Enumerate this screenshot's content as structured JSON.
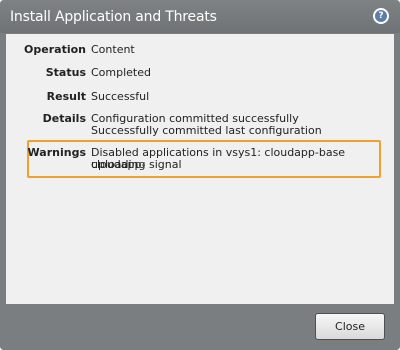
{
  "dialog": {
    "title": "Install Application and Threats",
    "help_icon": "question-mark-icon",
    "close_label": "Close"
  },
  "fields": {
    "operation": {
      "label": "Operation",
      "value": "Content"
    },
    "status": {
      "label": "Status",
      "value": "Completed"
    },
    "result": {
      "label": "Result",
      "value": "Successful"
    },
    "details": {
      "label": "Details",
      "lines": [
        "Configuration committed successfully",
        "Successfully committed last configuration"
      ]
    },
    "warnings": {
      "label": "Warnings",
      "lines": [
        "Disabled applications in vsys1: cloudapp-base cloudapp-",
        "uploading signal"
      ]
    }
  },
  "colors": {
    "frame": "#7a7e80",
    "panel": "#f0f0f0",
    "highlight": "#f0a030",
    "help_icon": "#5b7fa8"
  }
}
